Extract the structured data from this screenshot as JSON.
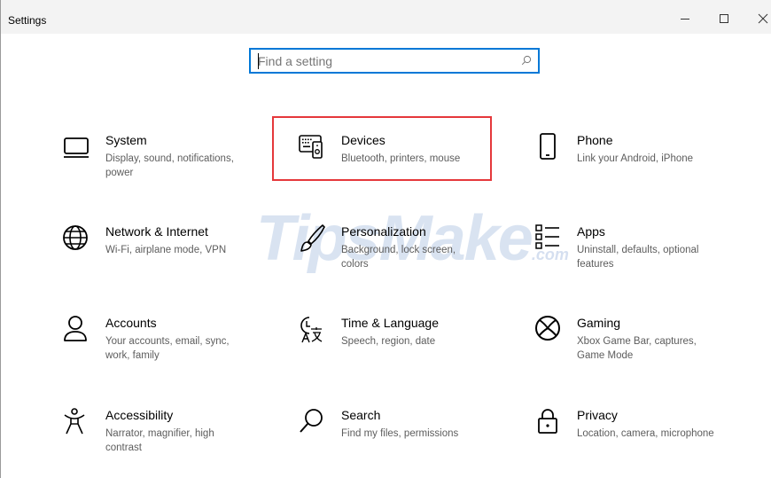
{
  "window": {
    "title": "Settings",
    "minimize_icon": "minimize-icon",
    "maximize_icon": "maximize-icon",
    "close_icon": "close-icon"
  },
  "search": {
    "placeholder": "Find a setting",
    "value": "",
    "icon": "search-icon",
    "border_color": "#0078d7"
  },
  "tiles": [
    {
      "name": "System",
      "description": "Display, sound, notifications, power",
      "icon": "monitor-icon"
    },
    {
      "name": "Devices",
      "description": "Bluetooth, printers, mouse",
      "icon": "keyboard-speaker-icon",
      "highlighted": true
    },
    {
      "name": "Phone",
      "description": "Link your Android, iPhone",
      "icon": "phone-icon"
    },
    {
      "name": "Network & Internet",
      "description": "Wi-Fi, airplane mode, VPN",
      "icon": "globe-icon"
    },
    {
      "name": "Personalization",
      "description": "Background, lock screen, colors",
      "icon": "paintbrush-icon"
    },
    {
      "name": "Apps",
      "description": "Uninstall, defaults, optional features",
      "icon": "apps-list-icon"
    },
    {
      "name": "Accounts",
      "description": "Your accounts, email, sync, work, family",
      "icon": "person-icon"
    },
    {
      "name": "Time & Language",
      "description": "Speech, region, date",
      "icon": "time-language-icon"
    },
    {
      "name": "Gaming",
      "description": "Xbox Game Bar, captures, Game Mode",
      "icon": "xbox-icon"
    },
    {
      "name": "Accessibility",
      "description": "Narrator, magnifier, high contrast",
      "icon": "accessibility-icon"
    },
    {
      "name": "Search",
      "description": "Find my files, permissions",
      "icon": "magnifier-icon"
    },
    {
      "name": "Privacy",
      "description": "Location, camera, microphone",
      "icon": "lock-icon"
    }
  ],
  "highlight_color": "#e5383b",
  "watermark": {
    "text": "TipsMake",
    "suffix": ".com"
  }
}
